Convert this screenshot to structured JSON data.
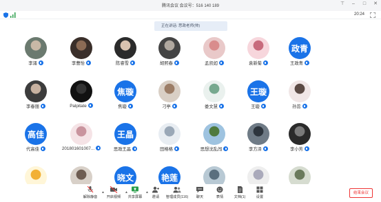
{
  "window": {
    "title": "腾讯会议 会议号：516 140 189"
  },
  "subbar": {
    "clock": "20:24"
  },
  "speaking_banner": "正在讲话: 思政老师(帅)",
  "participants": [
    {
      "name": "李涌",
      "avatar_text": ""
    },
    {
      "name": "李曹怡",
      "avatar_text": ""
    },
    {
      "name": "陈睿雪",
      "avatar_text": ""
    },
    {
      "name": "胡熙春",
      "avatar_text": ""
    },
    {
      "name": "孟凯如",
      "avatar_text": ""
    },
    {
      "name": "袁新菊",
      "avatar_text": ""
    },
    {
      "name": "王政青",
      "avatar_text": "政青"
    },
    {
      "name": "李春丽",
      "avatar_text": ""
    },
    {
      "name": "Palpitate",
      "avatar_text": ""
    },
    {
      "name": "焦璇",
      "avatar_text": "焦璇"
    },
    {
      "name": "刁亭",
      "avatar_text": ""
    },
    {
      "name": "娄文慧",
      "avatar_text": ""
    },
    {
      "name": "王璇",
      "avatar_text": "王璇"
    },
    {
      "name": "孙蕊",
      "avatar_text": ""
    },
    {
      "name": "代高佳",
      "avatar_text": "高佳"
    },
    {
      "name": "2018016010​07...",
      "avatar_text": ""
    },
    {
      "name": "思政王晶",
      "avatar_text": "王晶"
    },
    {
      "name": "田格格",
      "avatar_text": ""
    },
    {
      "name": "思想沈乱闯",
      "avatar_text": ""
    },
    {
      "name": "李方泽",
      "avatar_text": ""
    },
    {
      "name": "李小芳",
      "avatar_text": ""
    },
    {
      "name": "",
      "avatar_text": ""
    },
    {
      "name": "",
      "avatar_text": ""
    },
    {
      "name": "",
      "avatar_text": "晓文"
    },
    {
      "name": "",
      "avatar_text": "艳莲"
    },
    {
      "name": "",
      "avatar_text": ""
    },
    {
      "name": "",
      "avatar_text": ""
    },
    {
      "name": "",
      "avatar_text": ""
    }
  ],
  "toolbar": {
    "mute": "解除静音",
    "video": "开启视频",
    "share": "共享屏幕",
    "invite": "邀请",
    "members": "管理成员(116)",
    "chat": "聊天",
    "emoji": "表情",
    "docs": "文档(1)",
    "settings": "设置",
    "end": "结束会议"
  },
  "colors": {
    "accent": "#1a73e8",
    "danger": "#ee3333"
  }
}
